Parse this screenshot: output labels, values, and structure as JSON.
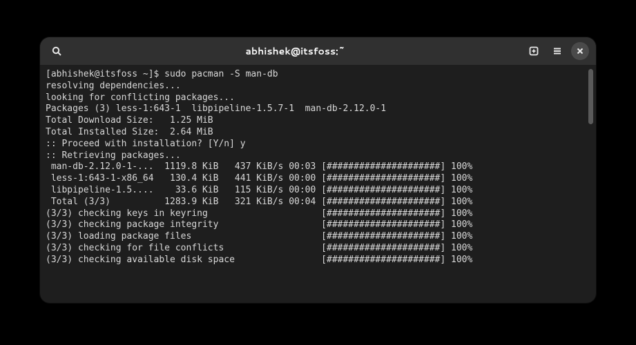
{
  "titlebar": {
    "title": "abhishek@itsfoss:~"
  },
  "terminal": {
    "lines": [
      "[abhishek@itsfoss ~]$ sudo pacman -S man-db",
      "resolving dependencies...",
      "looking for conflicting packages...",
      "",
      "Packages (3) less-1:643-1  libpipeline-1.5.7-1  man-db-2.12.0-1",
      "",
      "Total Download Size:   1.25 MiB",
      "Total Installed Size:  2.64 MiB",
      "",
      ":: Proceed with installation? [Y/n] y",
      ":: Retrieving packages...",
      " man-db-2.12.0-1-...  1119.8 KiB   437 KiB/s 00:03 [#####################] 100%",
      " less-1:643-1-x86_64   130.4 KiB   441 KiB/s 00:00 [#####################] 100%",
      " libpipeline-1.5....    33.6 KiB   115 KiB/s 00:00 [#####################] 100%",
      " Total (3/3)          1283.9 KiB   321 KiB/s 00:04 [#####################] 100%",
      "(3/3) checking keys in keyring                     [#####################] 100%",
      "(3/3) checking package integrity                   [#####################] 100%",
      "(3/3) loading package files                        [#####################] 100%",
      "(3/3) checking for file conflicts                  [#####################] 100%",
      "(3/3) checking available disk space                [#####################] 100%"
    ]
  }
}
